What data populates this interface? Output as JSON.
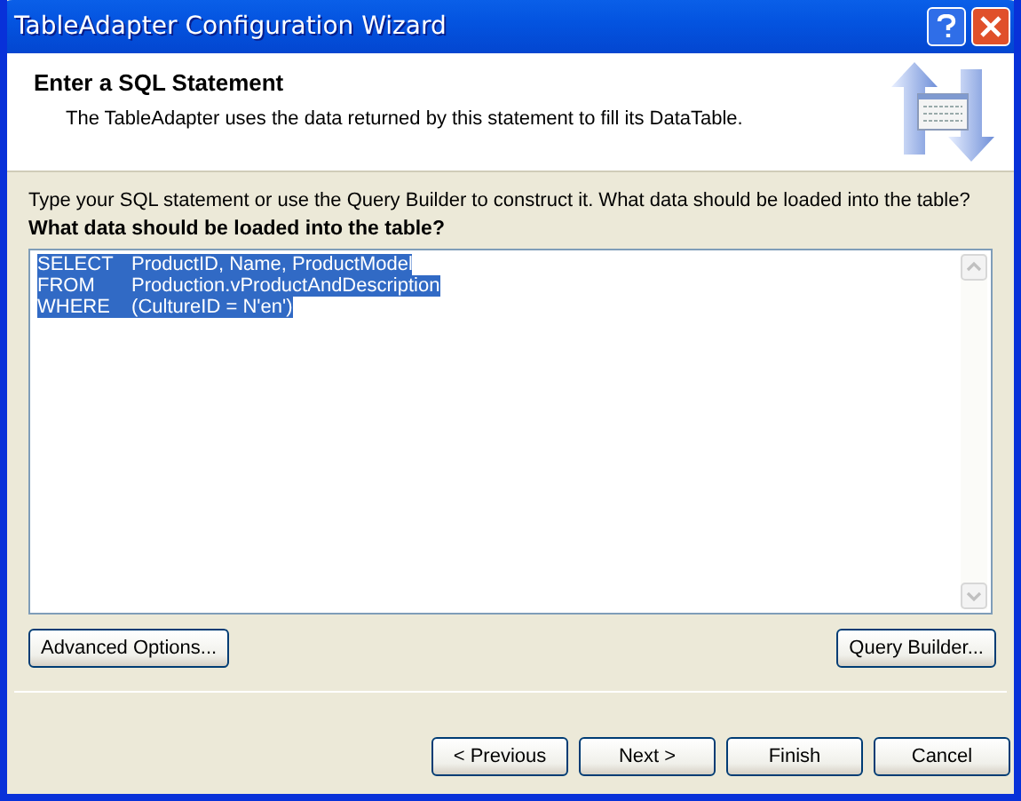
{
  "window": {
    "title": "TableAdapter Configuration Wizard"
  },
  "header": {
    "title": "Enter a SQL Statement",
    "description": "The TableAdapter uses the data returned by this statement to fill its DataTable."
  },
  "instructions": "Type your SQL statement or use the Query Builder to construct it. What data should be loaded into the table?",
  "sql_label": "What data should be loaded into the table?",
  "sql_editor": {
    "selected": true,
    "lines": [
      {
        "keyword": "SELECT",
        "text": "ProductID, Name, ProductModel"
      },
      {
        "keyword": "FROM",
        "text": "Production.vProductAndDescription"
      },
      {
        "keyword": "WHERE",
        "text": "(CultureID = N'en')"
      }
    ]
  },
  "advanced_button": "Advanced Options...",
  "query_builder_button": "Query Builder...",
  "nav_buttons": [
    {
      "label": "< Previous"
    },
    {
      "label": "Next >"
    },
    {
      "label": "Finish"
    },
    {
      "label": "Cancel"
    }
  ]
}
